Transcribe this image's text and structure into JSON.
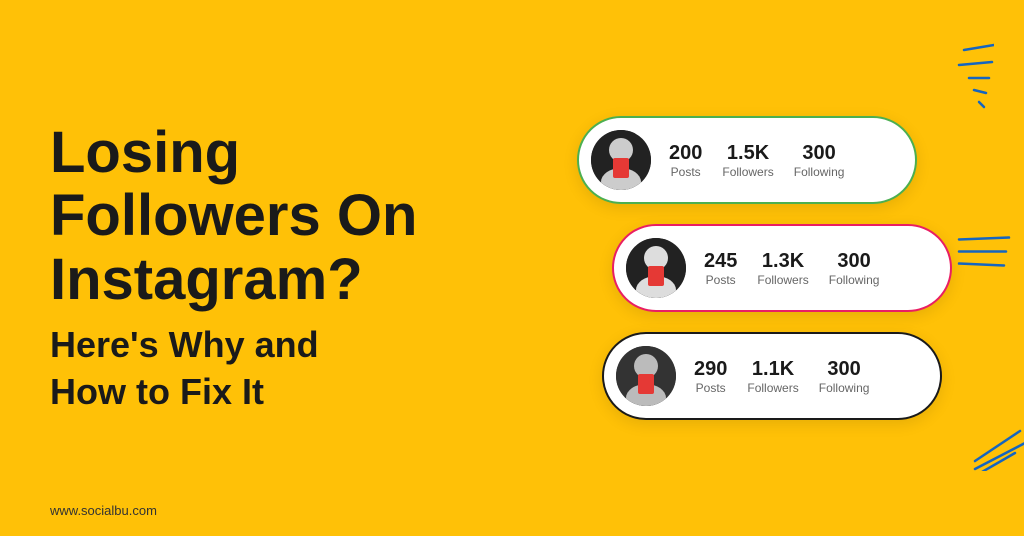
{
  "page": {
    "background_color": "#FFC107",
    "website": "www.socialbu.com"
  },
  "left": {
    "main_title": "Losing\nFollowers On\nInstagram?",
    "sub_title": "Here's Why and\nHow to Fix It"
  },
  "cards": [
    {
      "id": "card-1",
      "border_color": "#4CAF50",
      "stats": [
        {
          "number": "200",
          "label": "Posts"
        },
        {
          "number": "1.5K",
          "label": "Followers"
        },
        {
          "number": "300",
          "label": "Following"
        }
      ]
    },
    {
      "id": "card-2",
      "border_color": "#E91E63",
      "stats": [
        {
          "number": "245",
          "label": "Posts"
        },
        {
          "number": "1.3K",
          "label": "Followers"
        },
        {
          "number": "300",
          "label": "Following"
        }
      ]
    },
    {
      "id": "card-3",
      "border_color": "#1a1a1a",
      "stats": [
        {
          "number": "290",
          "label": "Posts"
        },
        {
          "number": "1.1K",
          "label": "Followers"
        },
        {
          "number": "300",
          "label": "Following"
        }
      ]
    }
  ]
}
